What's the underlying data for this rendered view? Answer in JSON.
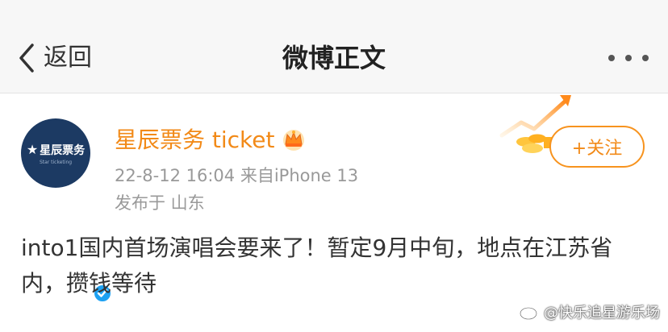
{
  "navbar": {
    "back_label": "返回",
    "title": "微博正文",
    "more_icon": "more-dots-icon"
  },
  "post": {
    "author": {
      "name": "星辰票务 ticket",
      "avatar_text": "星辰票务",
      "avatar_subtext": "Star ticketing",
      "verified_icon": "verified-badge-icon",
      "crown_icon": "crown-icon"
    },
    "time_source": "22-8-12 16:04  来自iPhone 13",
    "location": "发布于 山东",
    "follow_label": "+关注",
    "content": "into1国内首场演唱会要来了！暂定9月中旬，地点在江苏省内，攒钱等待"
  },
  "watermark": "@快乐追星游乐场",
  "colors": {
    "accent": "#f28a18",
    "navbar_bg": "#f7f7f7",
    "meta_text": "#999999",
    "avatar_bg": "#1c3a63",
    "verified": "#1da1f2"
  }
}
